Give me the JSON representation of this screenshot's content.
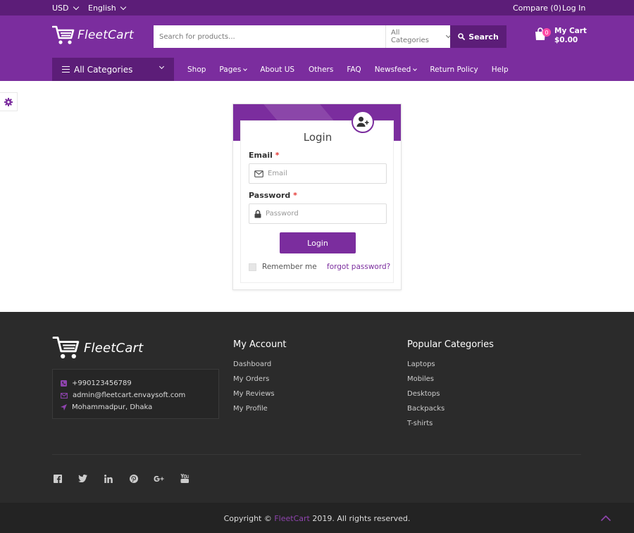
{
  "topbar": {
    "currency": "USD",
    "language": "English",
    "compare": "Compare (0)",
    "login": "Log In"
  },
  "header": {
    "brand": "FleetCart",
    "search_placeholder": "Search for products...",
    "category_select": "All Categories",
    "search_button": "Search",
    "cart_count": "0",
    "cart_label": "My Cart",
    "cart_total": "$0.00"
  },
  "nav": {
    "all_categories": "All Categories",
    "items": [
      "Shop",
      "Pages",
      "About US",
      "Others",
      "FAQ",
      "Newsfeed",
      "Return Policy",
      "Help"
    ]
  },
  "login": {
    "title": "Login",
    "email_label": "Email",
    "email_placeholder": "Email",
    "password_label": "Password",
    "password_placeholder": "Password",
    "required_mark": "*",
    "button": "Login",
    "remember": "Remember me",
    "forgot": "forgot password?"
  },
  "footer": {
    "brand": "FleetCart",
    "phone": "+990123456789",
    "email": "admin@fleetcart.envaysoft.com",
    "address": "Mohammadpur, Dhaka",
    "my_account_title": "My Account",
    "my_account": [
      "Dashboard",
      "My Orders",
      "My Reviews",
      "My Profile"
    ],
    "popular_title": "Popular Categories",
    "popular": [
      "Laptops",
      "Mobiles",
      "Desktops",
      "Backpacks",
      "T-shirts"
    ],
    "copyright_prefix": "Copyright ©",
    "copyright_brand": "FleetCart",
    "copyright_suffix": "2019. All rights reserved."
  },
  "colors": {
    "primary": "#7b2d9e",
    "primary_dark": "#5c1d78",
    "badge": "#ff4aa6",
    "footer_bg": "#2b2b2b"
  }
}
